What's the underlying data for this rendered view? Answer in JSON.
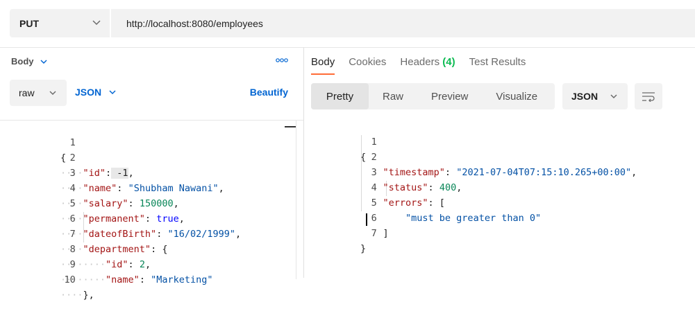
{
  "request": {
    "method": "PUT",
    "url": "http://localhost:8080/employees"
  },
  "request_body": {
    "body_label": "Body",
    "raw_label": "raw",
    "json_label": "JSON",
    "beautify_label": "Beautify",
    "lines": [
      {
        "n": "1",
        "text": "{"
      },
      {
        "n": "2",
        "text": "    \"id\": -1,"
      },
      {
        "n": "3",
        "text": "    \"name\": \"Shubham Nawani\","
      },
      {
        "n": "4",
        "text": "    \"salary\": 150000,"
      },
      {
        "n": "5",
        "text": "    \"permanent\": true,"
      },
      {
        "n": "6",
        "text": "    \"dateofBirth\": \"16/02/1999\","
      },
      {
        "n": "7",
        "text": "    \"department\": {"
      },
      {
        "n": "8",
        "text": "        \"id\": 2,"
      },
      {
        "n": "9",
        "text": "        \"name\": \"Marketing\""
      },
      {
        "n": "10",
        "text": "    },"
      }
    ]
  },
  "response": {
    "tabs": {
      "body": "Body",
      "cookies": "Cookies",
      "headers": "Headers",
      "headers_count": "(4)",
      "tests": "Test Results"
    },
    "view": {
      "pretty": "Pretty",
      "raw": "Raw",
      "preview": "Preview",
      "visualize": "Visualize"
    },
    "format": "JSON",
    "lines": [
      {
        "n": "1",
        "text": "{"
      },
      {
        "n": "2",
        "text": "    \"timestamp\": \"2021-07-04T07:15:10.265+00:00\","
      },
      {
        "n": "3",
        "text": "    \"status\": 400,"
      },
      {
        "n": "4",
        "text": "    \"errors\": ["
      },
      {
        "n": "5",
        "text": "        \"must be greater than 0\""
      },
      {
        "n": "6",
        "text": "    ]"
      },
      {
        "n": "7",
        "text": "}"
      }
    ]
  },
  "colors": {
    "accent": "#ff6c37",
    "link": "#0265d2",
    "badge": "#0cbb52",
    "json_key": "#a31515",
    "json_string": "#0451a5",
    "json_number": "#098658",
    "json_bool": "#0000ff"
  }
}
